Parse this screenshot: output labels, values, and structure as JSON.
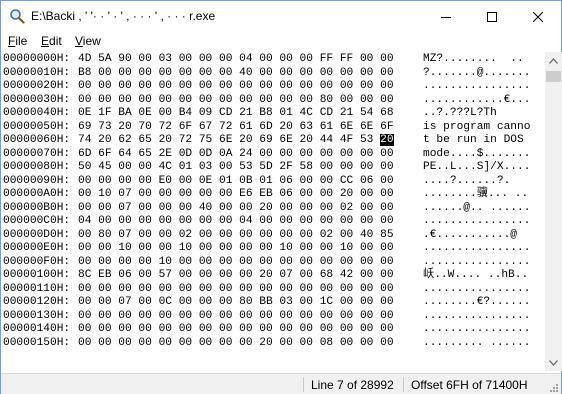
{
  "window": {
    "title": "E:\\Backi , ' ",
    "title_full": "E:\\Backi , ' '· · ' · ' , · · · ' , · · · r.exe"
  },
  "menu": [
    {
      "label": "File",
      "underline": "F"
    },
    {
      "label": "Edit",
      "underline": "E"
    },
    {
      "label": "View",
      "underline": "V"
    }
  ],
  "rows": [
    {
      "addr": "00000000H:",
      "hex": "4D 5A 90 00 03 00 00 00 04 00 00 00 FF FF 00 00",
      "ascii": "MZ?........  .."
    },
    {
      "addr": "00000010H:",
      "hex": "B8 00 00 00 00 00 00 00 40 00 00 00 00 00 00 00",
      "ascii": "?.......@......."
    },
    {
      "addr": "00000020H:",
      "hex": "00 00 00 00 00 00 00 00 00 00 00 00 00 00 00 00",
      "ascii": "................"
    },
    {
      "addr": "00000030H:",
      "hex": "00 00 00 00 00 00 00 00 00 00 00 00 80 00 00 00",
      "ascii": "............€..."
    },
    {
      "addr": "00000040H:",
      "hex": "0E 1F BA 0E 00 B4 09 CD 21 B8 01 4C CD 21 54 68",
      "ascii": "..?.???L?Th"
    },
    {
      "addr": "00000050H:",
      "hex": "69 73 20 70 72 6F 67 72 61 6D 20 63 61 6E 6E 6F",
      "ascii": "is program canno"
    },
    {
      "addr": "00000060H:",
      "hex": "74 20 62 65 20 72 75 6E 20 69 6E 20 44 4F 53 ",
      "sel": "20",
      "ascii": "t be run in DOS "
    },
    {
      "addr": "00000070H:",
      "hex": "6D 6F 64 65 2E 0D 0D 0A 24 00 00 00 00 00 00 00",
      "ascii": "mode....$......."
    },
    {
      "addr": "00000080H:",
      "hex": "50 45 00 00 4C 01 03 00 53 5D 2F 58 00 00 00 00",
      "ascii": "PE..L...S]/X...."
    },
    {
      "addr": "00000090H:",
      "hex": "00 00 00 00 E0 00 0E 01 0B 01 06 00 00 CC 06 00",
      "ascii": "....?......?."
    },
    {
      "addr": "000000A0H:",
      "hex": "00 10 07 00 00 00 00 00 E6 EB 06 00 00 20 00 00",
      "ascii": "........骥... .."
    },
    {
      "addr": "000000B0H:",
      "hex": "00 00 07 00 00 00 40 00 00 20 00 00 00 02 00 00",
      "ascii": "......@.. ......"
    },
    {
      "addr": "000000C0H:",
      "hex": "04 00 00 00 00 00 00 00 04 00 00 00 00 00 00 00",
      "ascii": "................"
    },
    {
      "addr": "000000D0H:",
      "hex": "00 80 07 00 00 02 00 00 00 00 00 00 02 00 40 85",
      "ascii": ".€...........@"
    },
    {
      "addr": "000000E0H:",
      "hex": "00 00 10 00 00 10 00 00 00 00 10 00 00 10 00 00",
      "ascii": "................"
    },
    {
      "addr": "000000F0H:",
      "hex": "00 00 00 00 10 00 00 00 00 00 00 00 00 00 00 00",
      "ascii": "................"
    },
    {
      "addr": "00000100H:",
      "hex": "8C EB 06 00 57 00 00 00 00 20 07 00 68 42 00 00",
      "ascii": "岆..W.... ..hB.."
    },
    {
      "addr": "00000110H:",
      "hex": "00 00 00 00 00 00 00 00 00 00 00 00 00 00 00 00",
      "ascii": "................"
    },
    {
      "addr": "00000120H:",
      "hex": "00 00 07 00 0C 00 00 00 80 BB 03 00 1C 00 00 00",
      "ascii": "........€?......"
    },
    {
      "addr": "00000130H:",
      "hex": "00 00 00 00 00 00 00 00 00 00 00 00 00 00 00 00",
      "ascii": "................"
    },
    {
      "addr": "00000140H:",
      "hex": "00 00 00 00 00 00 00 00 00 00 00 00 00 00 00 00",
      "ascii": "................"
    },
    {
      "addr": "00000150H:",
      "hex": "00 00 00 00 00 00 00 00 00 20 00 00 08 00 00 00",
      "ascii": "......... ......"
    }
  ],
  "status": {
    "line": "Line  7 of 28992",
    "offset": "Offset  6FH of 71400H"
  },
  "colors": {
    "selection_bg": "#000000",
    "selection_fg": "#ffffff",
    "statusbar_bg": "#f0f0f0",
    "scrollbar_bg": "#f0f0f0"
  },
  "icons": [
    "magnifier-app-icon",
    "minimize-icon",
    "maximize-icon",
    "close-icon",
    "scroll-up-arrow-icon",
    "scroll-down-arrow-icon",
    "size-grip-icon"
  ]
}
